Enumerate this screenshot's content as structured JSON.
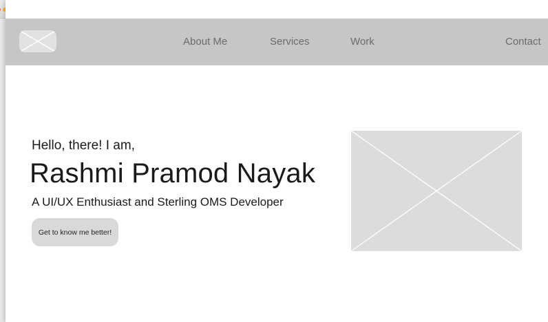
{
  "header": {
    "nav": {
      "about": "About Me",
      "services": "Services",
      "work": "Work",
      "contact": "Contact"
    }
  },
  "hero": {
    "greeting": "Hello, there! I am,",
    "name": "Rashmi Pramod Nayak",
    "tagline": "A UI/UX Enthusiast and Sterling OMS Developer",
    "cta_label": "Get to know me better!"
  },
  "icons": {
    "logo": "image-placeholder-icon",
    "hero_image": "image-placeholder-icon",
    "back": "chevron-left-icon",
    "forward": "chevron-right-icon",
    "reload": "reload-icon",
    "share": "share-icon",
    "tabs": "tabs-icon"
  },
  "colors": {
    "header_bg": "#c6c6c6",
    "nav_text": "#6b6b6b",
    "placeholder_bg": "#dcdcdc",
    "cta_bg": "#d9d9d9",
    "page_bg": "#ffffff"
  }
}
